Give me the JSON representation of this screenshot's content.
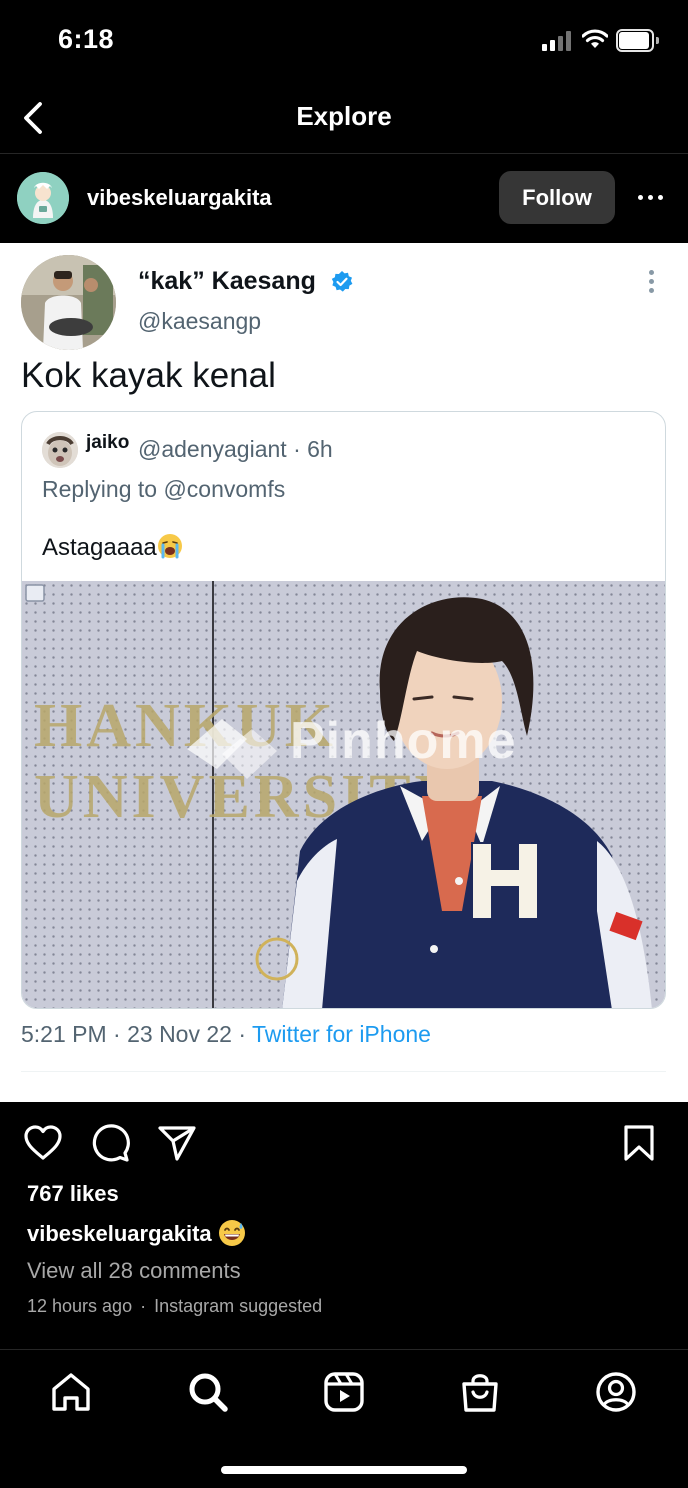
{
  "status_bar": {
    "time": "6:18"
  },
  "nav": {
    "title": "Explore",
    "back_icon": "chevron-left-icon"
  },
  "post": {
    "username": "vibeskeluargakita",
    "follow_label": "Follow",
    "more_icon": "more-horizontal-icon",
    "image": {
      "tweet": {
        "author_name": "“kak” Kaesang",
        "author_handle": "@kaesangp",
        "verified": true,
        "text": "Kok kayak kenal",
        "quote": {
          "name": "jaiko",
          "handle_time": "@adenyagiant · 6h",
          "replying_to": "Replying to @convomfs",
          "text": "Astagaaaa",
          "text_emoji": "loudly-crying-face",
          "photo_sign_text": "HANKUK UNIVERSITY",
          "watermark": "Pinhome"
        },
        "timestamp": "5:21 PM · 23 Nov 22 · ",
        "source": "Twitter for iPhone"
      }
    },
    "actions": {
      "like_icon": "heart-icon",
      "comment_icon": "comment-icon",
      "share_icon": "send-icon",
      "save_icon": "bookmark-icon"
    },
    "likes": "767 likes",
    "caption_user": "vibeskeluargakita",
    "caption_emoji": "grinning-face-with-sweat",
    "view_comments": "View all 28 comments",
    "time_ago": "12 hours ago",
    "suggested": "Instagram suggested"
  },
  "bottom_nav": {
    "items": [
      "home-icon",
      "search-icon",
      "reels-icon",
      "shop-icon",
      "profile-icon"
    ],
    "active": "search"
  },
  "colors": {
    "background": "#000000",
    "follow_button": "#363636",
    "secondary_text": "#a8a8a8",
    "twitter_blue": "#1d9bf0"
  }
}
